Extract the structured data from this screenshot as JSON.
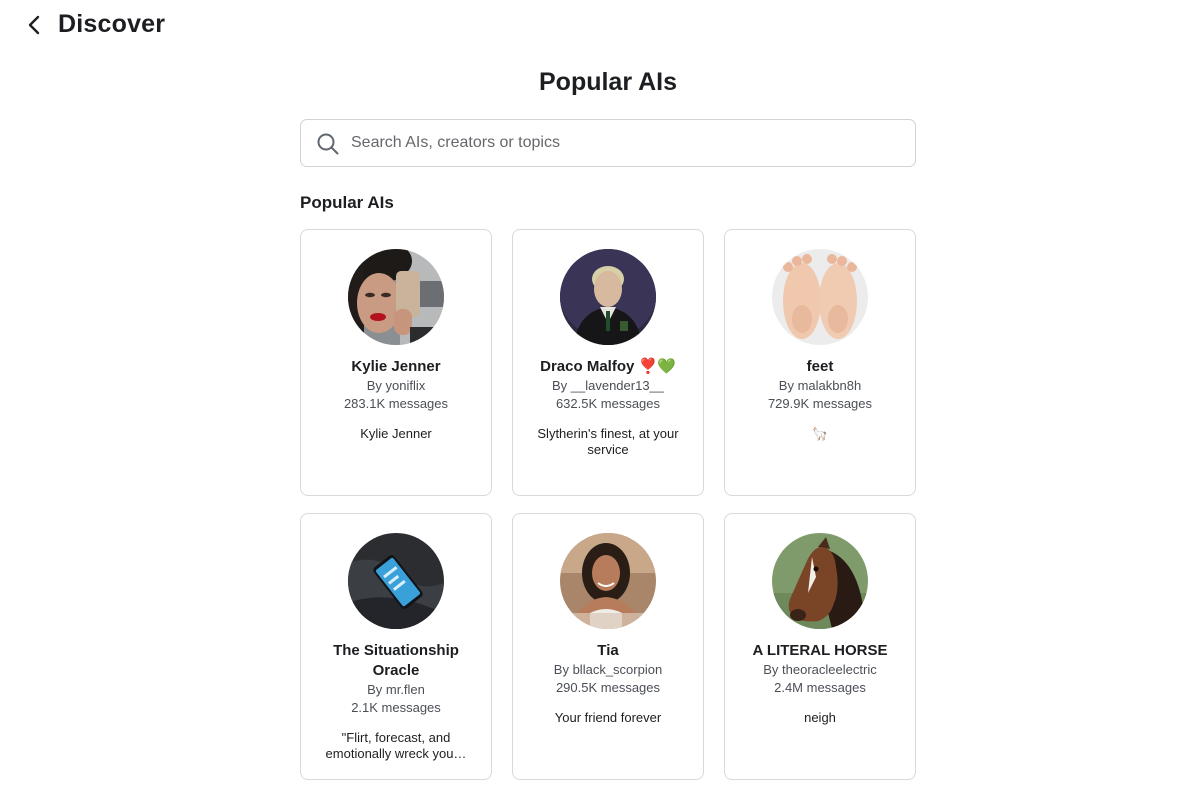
{
  "header": {
    "title": "Discover",
    "back_icon": "chevron-left-icon"
  },
  "main": {
    "heading": "Popular AIs",
    "search": {
      "placeholder": "Search AIs, creators or topics",
      "value": "",
      "icon": "search-icon"
    },
    "section_title": "Popular AIs",
    "cards": [
      {
        "name": "Kylie Jenner",
        "creator": "By yoniflix",
        "messages": "283.1K messages",
        "description": "Kylie Jenner"
      },
      {
        "name": "Draco Malfoy ❣️💚",
        "creator": "By __lavender13__",
        "messages": "632.5K messages",
        "description": "Slytherin's finest, at your service"
      },
      {
        "name": "feet",
        "creator": "By malakbn8h",
        "messages": "729.9K messages",
        "description": "🦙"
      },
      {
        "name": "The Situationship Oracle",
        "creator": "By mr.flen",
        "messages": "2.1K messages",
        "description": "\"Flirt, forecast, and emotionally wreck you…"
      },
      {
        "name": "Tia",
        "creator": "By bllack_scorpion",
        "messages": "290.5K messages",
        "description": "Your friend forever"
      },
      {
        "name": "A LITERAL HORSE",
        "creator": "By theoracleelectric",
        "messages": "2.4M messages",
        "description": "neigh"
      }
    ]
  }
}
